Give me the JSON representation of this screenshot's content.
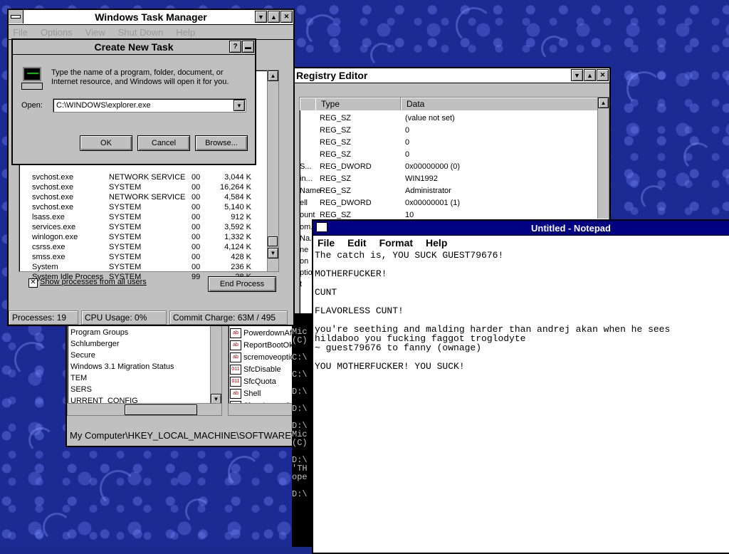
{
  "task_manager": {
    "title": "Windows Task Manager",
    "menu": [
      "File",
      "Options",
      "View",
      "Shut Down",
      "Help"
    ],
    "processes": [
      {
        "name": "svchost.exe",
        "user": "NETWORK SERVICE",
        "cpu": "00",
        "mem": "3,044 K"
      },
      {
        "name": "svchost.exe",
        "user": "SYSTEM",
        "cpu": "00",
        "mem": "16,264 K"
      },
      {
        "name": "svchost.exe",
        "user": "NETWORK SERVICE",
        "cpu": "00",
        "mem": "4,584 K"
      },
      {
        "name": "svchost.exe",
        "user": "SYSTEM",
        "cpu": "00",
        "mem": "5,140 K"
      },
      {
        "name": "lsass.exe",
        "user": "SYSTEM",
        "cpu": "00",
        "mem": "912 K"
      },
      {
        "name": "services.exe",
        "user": "SYSTEM",
        "cpu": "00",
        "mem": "3,592 K"
      },
      {
        "name": "winlogon.exe",
        "user": "SYSTEM",
        "cpu": "00",
        "mem": "1,332 K"
      },
      {
        "name": "csrss.exe",
        "user": "SYSTEM",
        "cpu": "00",
        "mem": "4,124 K"
      },
      {
        "name": "smss.exe",
        "user": "SYSTEM",
        "cpu": "00",
        "mem": "428 K"
      },
      {
        "name": "System",
        "user": "SYSTEM",
        "cpu": "00",
        "mem": "236 K"
      },
      {
        "name": "System Idle Process",
        "user": "SYSTEM",
        "cpu": "99",
        "mem": "28 K"
      }
    ],
    "show_all_label": "Show processes from all users",
    "end_process_label": "End Process",
    "status": {
      "processes": "Processes: 19",
      "cpu": "CPU Usage: 0%",
      "commit": "Commit Charge: 63M / 495"
    }
  },
  "create_task": {
    "title": "Create New Task",
    "help_glyph": "?",
    "description_line1": "Type the name of a program, folder, document, or",
    "description_line2": "Internet resource, and Windows will open it for you.",
    "open_label": "Open:",
    "open_value": "C:\\WINDOWS\\explorer.exe",
    "ok_label": "OK",
    "cancel_label": "Cancel",
    "browse_label": "Browse..."
  },
  "registry_editor": {
    "title": "Registry Editor",
    "columns": [
      "Type",
      "Data"
    ],
    "rows": [
      {
        "name": "",
        "type": "REG_SZ",
        "data": "(value not set)"
      },
      {
        "name": "",
        "type": "REG_SZ",
        "data": "0"
      },
      {
        "name": "",
        "type": "REG_SZ",
        "data": "0"
      },
      {
        "name": "",
        "type": "REG_SZ",
        "data": "0"
      },
      {
        "name": "S...",
        "type": "REG_DWORD",
        "data": "0x00000000 (0)"
      },
      {
        "name": "in...",
        "type": "REG_SZ",
        "data": "WIN1992"
      },
      {
        "name": "Name",
        "type": "REG_SZ",
        "data": "Administrator"
      },
      {
        "name": "ell",
        "type": "REG_DWORD",
        "data": "0x00000001 (1)"
      },
      {
        "name": "ount",
        "type": "REG_SZ",
        "data": "10"
      }
    ],
    "tree_items": [
      "Program Groups",
      "Schlumberger",
      "Secure",
      "Windows 3.1 Migration Status",
      "TEM",
      "SERS",
      "URRENT_CONFIG"
    ],
    "value_items": [
      "PowerdownAf",
      "ReportBootOk",
      "scremoveoptio",
      "SfcDisable",
      "SfcQuota",
      "Shell",
      "ShowLogonO"
    ],
    "value_icons": [
      "ab",
      "ab",
      "ab",
      "011",
      "011",
      "ab",
      "ab"
    ],
    "partial_names": [
      "om...",
      "Na...",
      "ne",
      "on",
      "ption",
      "t"
    ],
    "status_path": "My Computer\\HKEY_LOCAL_MACHINE\\SOFTWARE\\Mic"
  },
  "notepad": {
    "title": "Untitled - Notepad",
    "menu": [
      "File",
      "Edit",
      "Format",
      "Help"
    ],
    "text": "The catch is, YOU SUCK GUEST79676!\n\nMOTHERFUCKER!\n\nCUNT\n\nFLAVORLESS CUNT!\n\nyou're seething and malding harder than andrej akan when he sees\nhildaboo you fucking faggot troglodyte\n~ guest79676 to fanny (ownage)\n\nYOU MOTHERFUCKER! YOU SUCK!"
  },
  "console": {
    "text": "Mic\n(C)\n\nC:\\\n\nC:\\\n\nD:\\\n\nD:\\\n\nD:\\\nMic\n(C)\n\nD:\\\n'TH\nope\n\nD:\\"
  }
}
